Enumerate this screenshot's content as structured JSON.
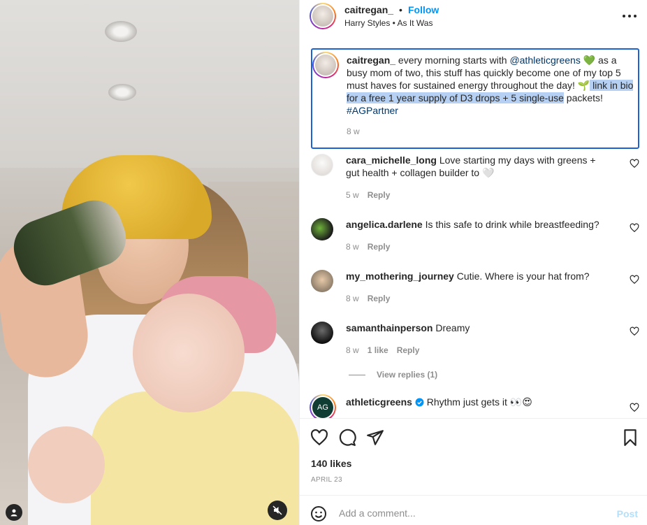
{
  "header": {
    "username": "caitregan_",
    "separator": "•",
    "follow_label": "Follow",
    "audio": "Harry Styles • As It Was"
  },
  "caption": {
    "username": "caitregan_",
    "text_1": " every morning starts with ",
    "mention": "@athleticgreens",
    "text_2": " 💚 as a busy mom of two, this stuff has quickly become one of my top 5 must haves for sustained energy throughout the day! 🌱",
    "highlighted": " link in bio for a free 1 year supply of D3 drops + 5 single-use",
    "text_3": " packets! ",
    "hashtag": "#AGPartner",
    "time": "8 w"
  },
  "comments": [
    {
      "username": "cara_michelle_long",
      "text": " Love starting my days with greens + gut health + collagen builder to 🤍",
      "time": "5 w",
      "reply": "Reply"
    },
    {
      "username": "angelica.darlene",
      "text": " Is this safe to drink while breastfeeding?",
      "time": "8 w",
      "reply": "Reply"
    },
    {
      "username": "my_mothering_journey",
      "text": " Cutie. Where is your hat from?",
      "time": "8 w",
      "reply": "Reply"
    },
    {
      "username": "samanthainperson",
      "text": " Dreamy",
      "time": "8 w",
      "likes": "1 like",
      "reply": "Reply"
    },
    {
      "username": "athleticgreens",
      "text": " Rhythm just gets it 👀😍",
      "avatar_text": "AG"
    }
  ],
  "view_replies": "View replies (1)",
  "post": {
    "likes": "140 likes",
    "date": "APRIL 23"
  },
  "add_comment": {
    "placeholder": "Add a comment...",
    "post_label": "Post"
  },
  "colors": {
    "accent": "#0095f6",
    "link": "#00376b",
    "highlight": "#b5d0f3",
    "selection_border": "#1d62d1",
    "muted": "#8e8e8e"
  },
  "icons": [
    "more-icon",
    "heart-icon",
    "comment-icon",
    "share-icon",
    "bookmark-icon",
    "emoji-icon",
    "user-tag-icon",
    "mute-icon",
    "verified-icon"
  ]
}
